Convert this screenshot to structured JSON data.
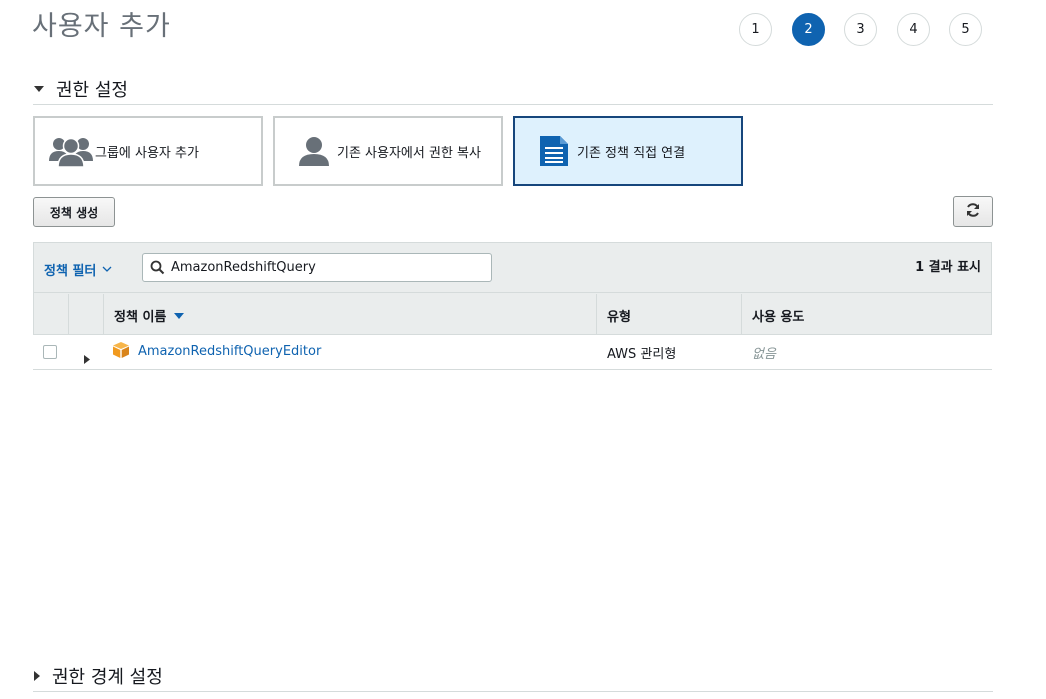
{
  "page": {
    "title": "사용자 추가"
  },
  "steps": [
    "1",
    "2",
    "3",
    "4",
    "5"
  ],
  "active_step": "2",
  "permissions_section": {
    "title": "권한 설정",
    "options": [
      {
        "label": "그룹에 사용자 추가",
        "icon": "users-group-icon",
        "selected": false
      },
      {
        "label": "기존 사용자에서 권한 복사",
        "icon": "user-icon",
        "selected": false
      },
      {
        "label": "기존 정책 직접 연결",
        "icon": "document-icon",
        "selected": true
      }
    ],
    "create_policy_button": "정책 생성",
    "refresh_icon": "refresh-icon"
  },
  "table": {
    "filter_label": "정책 필터",
    "search_value": "AmazonRedshiftQuery",
    "result_count": "1 결과 표시",
    "columns": [
      "정책 이름",
      "유형",
      "사용 용도"
    ],
    "sort_column": "정책 이름",
    "rows": [
      {
        "name": "AmazonRedshiftQueryEditor",
        "type": "AWS 관리형",
        "usage": "없음",
        "checked": false
      }
    ]
  },
  "boundary_section": {
    "title": "권한 경계 설정"
  },
  "colors": {
    "accent": "#0f63b0",
    "selected_bg": "#def1fd",
    "selected_border": "#16467c",
    "policy_icon": "#f19a1f"
  }
}
